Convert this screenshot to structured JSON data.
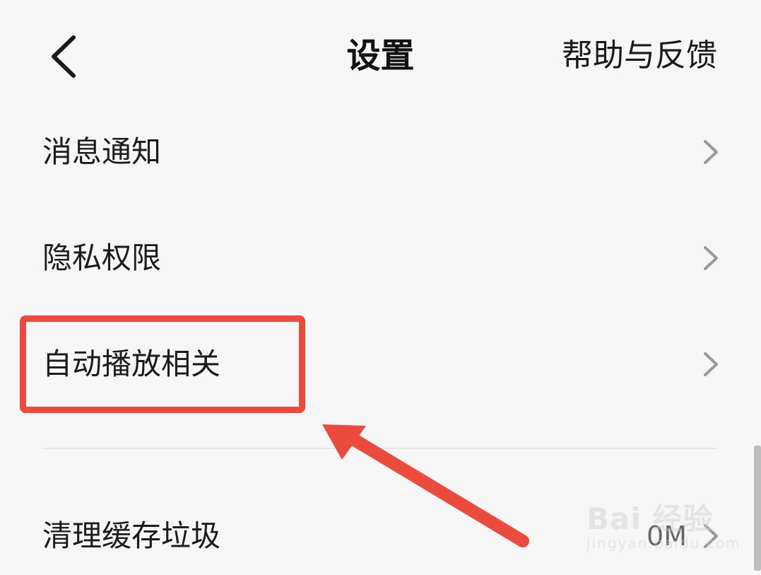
{
  "header": {
    "title": "设置",
    "help_label": "帮助与反馈"
  },
  "settings": {
    "items": [
      {
        "label": "消息通知"
      },
      {
        "label": "隐私权限"
      },
      {
        "label": "自动播放相关"
      },
      {
        "label": "清理缓存垃圾",
        "value": "0M"
      }
    ]
  },
  "watermark": {
    "logo": "Bai 经验",
    "sub": "jingyan.baidu.com"
  },
  "colors": {
    "background": "#f6f6f6",
    "annotation": "#ea4b3d"
  }
}
